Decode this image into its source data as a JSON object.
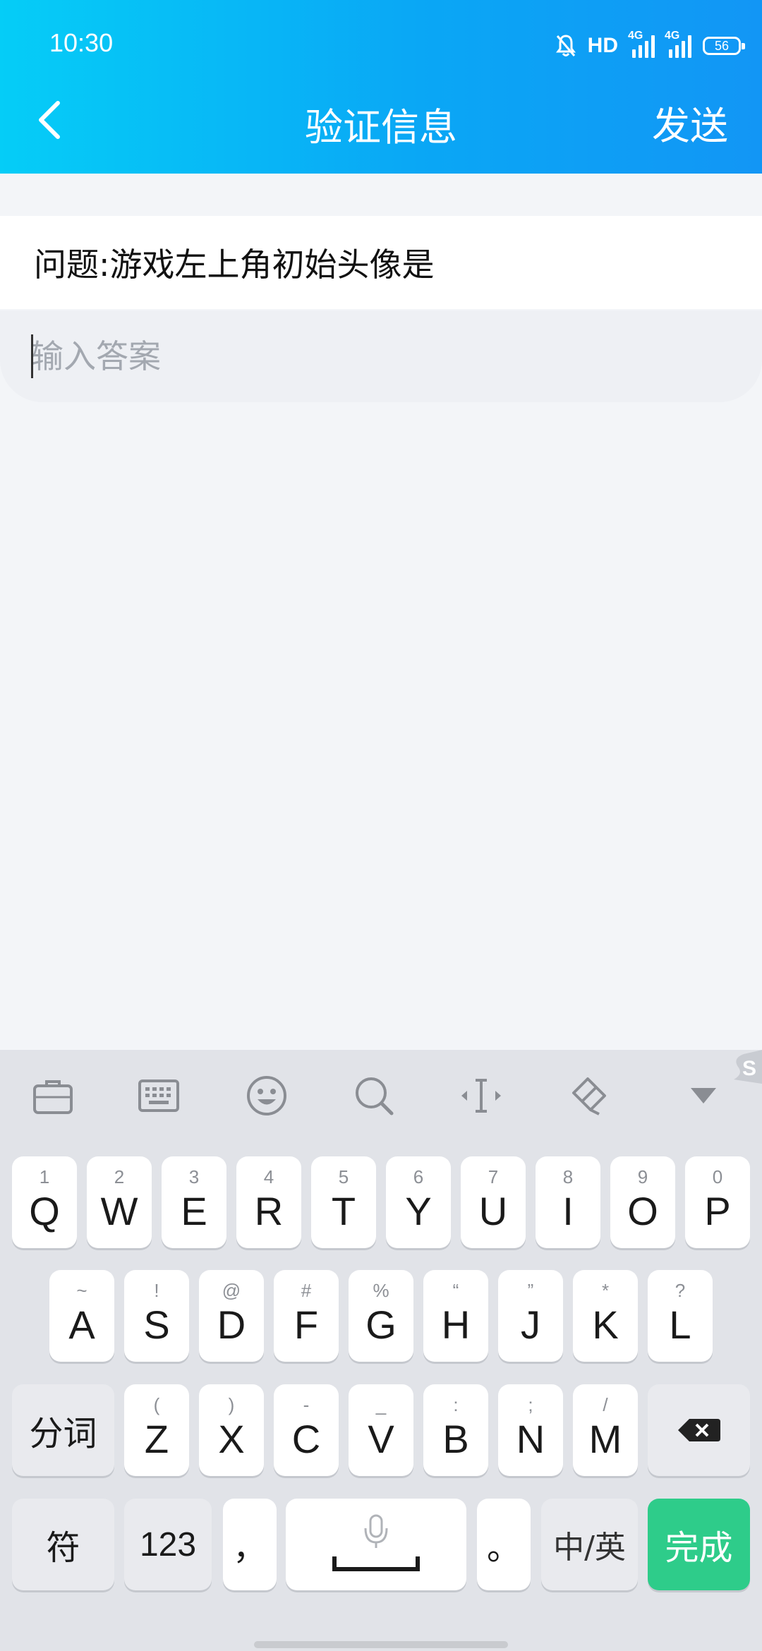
{
  "status_bar": {
    "time": "10:30",
    "hd_label": "HD",
    "net1_label": "4G",
    "net2_label": "4G",
    "battery": "56"
  },
  "nav": {
    "title": "验证信息",
    "send_label": "发送",
    "back_icon": "chevron-left-icon"
  },
  "question": {
    "text": "问题:游戏左上角初始头像是"
  },
  "answer": {
    "placeholder": "输入答案",
    "value": ""
  },
  "keyboard": {
    "toolbar": [
      "toolbox-icon",
      "keyboard-icon",
      "emoji-icon",
      "search-icon",
      "cursor-icon",
      "clipboard-icon",
      "hide-keyboard-icon"
    ],
    "row1": [
      {
        "key": "Q",
        "hint": "1"
      },
      {
        "key": "W",
        "hint": "2"
      },
      {
        "key": "E",
        "hint": "3"
      },
      {
        "key": "R",
        "hint": "4"
      },
      {
        "key": "T",
        "hint": "5"
      },
      {
        "key": "Y",
        "hint": "6"
      },
      {
        "key": "U",
        "hint": "7"
      },
      {
        "key": "I",
        "hint": "8"
      },
      {
        "key": "O",
        "hint": "9"
      },
      {
        "key": "P",
        "hint": "0"
      }
    ],
    "row2": [
      {
        "key": "A",
        "hint": "~"
      },
      {
        "key": "S",
        "hint": "!"
      },
      {
        "key": "D",
        "hint": "@"
      },
      {
        "key": "F",
        "hint": "#"
      },
      {
        "key": "G",
        "hint": "%"
      },
      {
        "key": "H",
        "hint": "“"
      },
      {
        "key": "J",
        "hint": "”"
      },
      {
        "key": "K",
        "hint": "*"
      },
      {
        "key": "L",
        "hint": "?"
      }
    ],
    "row3": [
      {
        "key": "Z",
        "hint": "("
      },
      {
        "key": "X",
        "hint": ")"
      },
      {
        "key": "C",
        "hint": "-"
      },
      {
        "key": "V",
        "hint": "_"
      },
      {
        "key": "B",
        "hint": ":"
      },
      {
        "key": "N",
        "hint": ";"
      },
      {
        "key": "M",
        "hint": "/"
      }
    ],
    "segment_label": "分词",
    "symbol_label": "符",
    "num_label": "123",
    "comma_label": "，",
    "period_label": "。",
    "lang_label": "中/英",
    "done_label": "完成"
  },
  "colors": {
    "header_start": "#05cdf7",
    "header_end": "#1296f5",
    "done_key": "#2ecc8a"
  }
}
